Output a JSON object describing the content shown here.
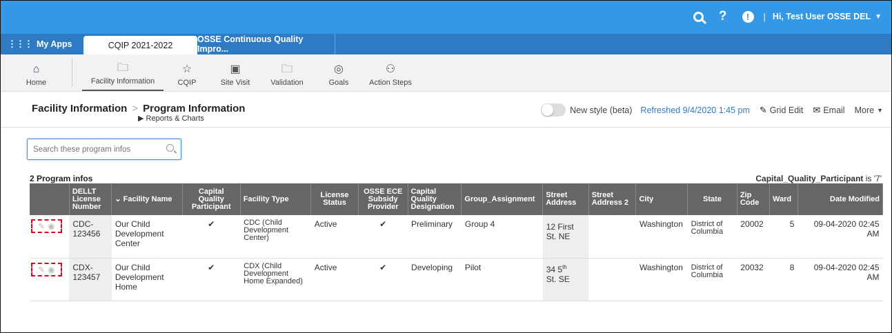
{
  "header": {
    "help_glyph": "?",
    "alert_glyph": "!",
    "separator": "|",
    "user_greeting": "Hi, Test User OSSE DEL"
  },
  "tabs": {
    "apps_label": "My Apps",
    "items": [
      {
        "label": "CQIP 2021-2022"
      },
      {
        "label": "OSSE Continuous Quality Impro..."
      }
    ]
  },
  "toolbar": {
    "items": [
      {
        "label": "Home"
      },
      {
        "label": "Facility Information"
      },
      {
        "label": "CQIP"
      },
      {
        "label": "Site Visit"
      },
      {
        "label": "Validation"
      },
      {
        "label": "Goals"
      },
      {
        "label": "Action Steps"
      }
    ]
  },
  "page": {
    "breadcrumb_parent": "Facility Information",
    "breadcrumb_sep": ">",
    "title": "Program Information",
    "subnav": "Reports & Charts",
    "toggle_label": "New style (beta)",
    "refreshed": "Refreshed 9/4/2020 1:45 pm",
    "grid_edit": "Grid Edit",
    "email": "Email",
    "more": "More"
  },
  "search": {
    "placeholder": "Search these program infos"
  },
  "list": {
    "count": "2 Program infos",
    "filter_field": "Capital_Quality_Participant",
    "filter_text": " is '7'"
  },
  "table": {
    "columns": [
      "DELLT License Number",
      "Facility Name",
      "Capital Quality Participant",
      "Facility Type",
      "License Status",
      "OSSE ECE Subsidy Provider",
      "Capital Quality Designation",
      "Group_Assignment",
      "Street Address",
      "Street Address 2",
      "City",
      "State",
      "Zip Code",
      "Ward",
      "Date Modified"
    ],
    "rows": [
      {
        "license": "CDC-123456",
        "name": "Our Child Development Center",
        "participant": "✔",
        "type": "CDC (Child Development Center)",
        "status": "Active",
        "subsidy": "✔",
        "designation": "Preliminary",
        "group": "Group 4",
        "street": "12 First St. NE",
        "street2": "",
        "city": "Washington",
        "state": "District of Columbia",
        "zip": "20002",
        "ward": "5",
        "modified": "09-04-2020 02:45 AM"
      },
      {
        "license": "CDX-123457",
        "name": "Our Child Development Home",
        "participant": "✔",
        "type": "CDX (Child Development Home Expanded)",
        "status": "Active",
        "subsidy": "✔",
        "designation": "Developing",
        "group": "Pilot",
        "street_num": "34 5",
        "street_sup": "th",
        "street_rest": "St. SE",
        "street2": "",
        "city": "Washington",
        "state": "District of Columbia",
        "zip": "20032",
        "ward": "8",
        "modified": "09-04-2020 02:45 AM"
      }
    ]
  }
}
